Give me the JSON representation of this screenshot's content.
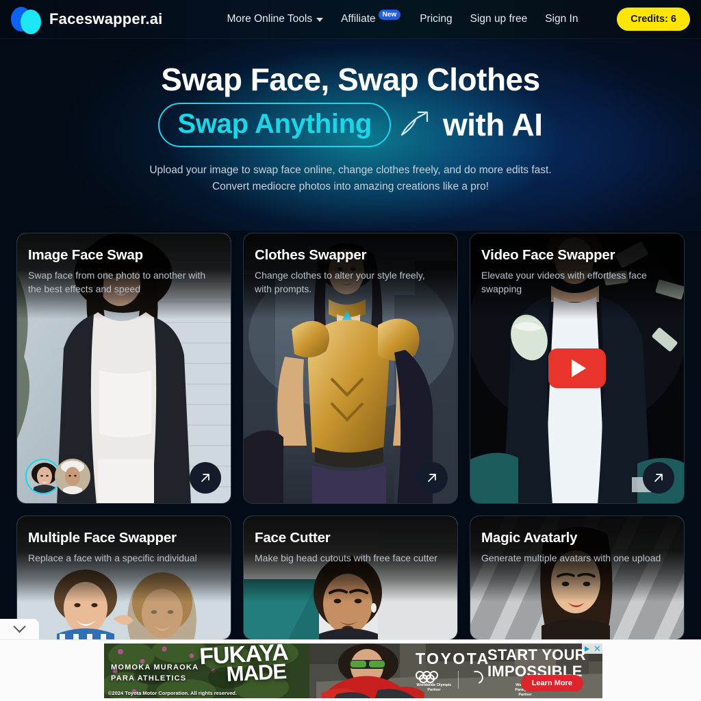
{
  "header": {
    "brand_name": "Faceswapper.ai",
    "nav": [
      {
        "label": "More Online Tools",
        "has_chevron": true,
        "badge": ""
      },
      {
        "label": "Affiliate",
        "has_chevron": false,
        "badge": "New"
      },
      {
        "label": "Pricing",
        "has_chevron": false,
        "badge": ""
      },
      {
        "label": "Sign up free",
        "has_chevron": false,
        "badge": ""
      },
      {
        "label": "Sign In",
        "has_chevron": false,
        "badge": ""
      }
    ],
    "credits_label": "Credits: 6",
    "credits_color": "#ffe600"
  },
  "hero": {
    "headline_line1": "Swap Face, Swap Clothes",
    "highlight": "Swap Anything",
    "highlight_color": "#18d7e8",
    "swoosh_icon": "hand-drawn-arrow-icon",
    "headline_tail": "with AI",
    "sub_line1": "Upload your image to swap face online, change clothes freely, and do more edits fast.",
    "sub_line2": "Convert mediocre photos into amazing creations like a pro!"
  },
  "cards": [
    {
      "title": "Image Face Swap",
      "desc": "Swap face from one photo to another with the best effects and speed",
      "arrow_icon": "arrow-up-right-icon",
      "has_avatars": true,
      "has_play": false
    },
    {
      "title": "Clothes Swapper",
      "desc": "Change clothes to alter your style freely, with prompts.",
      "arrow_icon": "arrow-up-right-icon",
      "has_avatars": false,
      "has_play": false
    },
    {
      "title": "Video Face Swapper",
      "desc": "Elevate your videos with effortless face swapping",
      "arrow_icon": "arrow-up-right-icon",
      "has_avatars": false,
      "has_play": true
    },
    {
      "title": "Multiple Face Swapper",
      "desc": "Replace a face with a specific individual",
      "arrow_icon": "",
      "has_avatars": false,
      "has_play": false
    },
    {
      "title": "Face Cutter",
      "desc": "Make big head cutouts with free face cutter",
      "arrow_icon": "",
      "has_avatars": false,
      "has_play": false
    },
    {
      "title": "Magic Avatarly",
      "desc": "Generate multiple avatars with one upload",
      "arrow_icon": "",
      "has_avatars": false,
      "has_play": false
    }
  ],
  "ad": {
    "collapse_icon": "chevron-down-icon",
    "athlete_line1": "MOMOKA MURAOKA",
    "athlete_line2": "PARA ATHLETICS",
    "made_line1": "FUKAYA",
    "made_line2": "MADE",
    "brand": "TOYOTA",
    "olympic_caption": "Worldwide Olympic Partner",
    "paralympic_caption": "Worldwide Paralympic Partner",
    "tagline_line1": "START YOUR",
    "tagline_line2": "IMPOSSIBLE",
    "cta_label": "Learn More",
    "cta_color": "#e0242b",
    "copyright": "©2024 Toyota Motor Corporation. All rights reserved.",
    "adchoices_icon": "adchoices-icon",
    "close_icon": "close-icon"
  }
}
